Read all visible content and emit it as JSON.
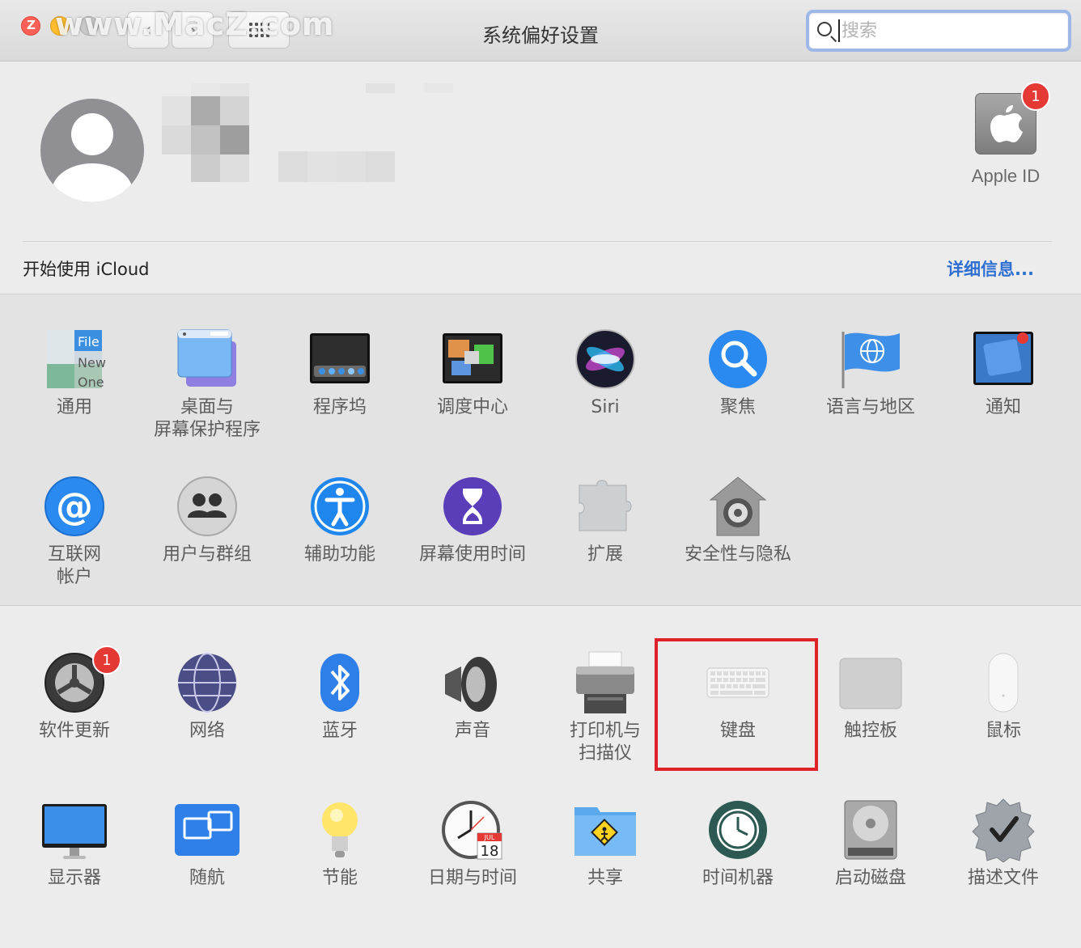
{
  "window": {
    "title": "系统偏好设置",
    "watermark": "www.MacZ.com"
  },
  "search": {
    "placeholder": "搜索",
    "value": ""
  },
  "account": {
    "apple_id_label": "Apple ID",
    "apple_id_badge": "1",
    "icloud_prompt": "开始使用 iCloud",
    "details_link": "详细信息..."
  },
  "section1": [
    {
      "label": "通用",
      "icon": "general-icon"
    },
    {
      "label": "桌面与\n屏幕保护程序",
      "icon": "desktop-screensaver-icon"
    },
    {
      "label": "程序坞",
      "icon": "dock-icon"
    },
    {
      "label": "调度中心",
      "icon": "mission-control-icon"
    },
    {
      "label": "Siri",
      "icon": "siri-icon"
    },
    {
      "label": "聚焦",
      "icon": "spotlight-icon"
    },
    {
      "label": "语言与地区",
      "icon": "language-region-icon"
    },
    {
      "label": "通知",
      "icon": "notifications-icon"
    },
    {
      "label": "互联网\n帐户",
      "icon": "internet-accounts-icon"
    },
    {
      "label": "用户与群组",
      "icon": "users-groups-icon"
    },
    {
      "label": "辅助功能",
      "icon": "accessibility-icon"
    },
    {
      "label": "屏幕使用时间",
      "icon": "screen-time-icon"
    },
    {
      "label": "扩展",
      "icon": "extensions-icon"
    },
    {
      "label": "安全性与隐私",
      "icon": "security-privacy-icon"
    }
  ],
  "section2": [
    {
      "label": "软件更新",
      "icon": "software-update-icon",
      "badge": "1"
    },
    {
      "label": "网络",
      "icon": "network-icon"
    },
    {
      "label": "蓝牙",
      "icon": "bluetooth-icon"
    },
    {
      "label": "声音",
      "icon": "sound-icon"
    },
    {
      "label": "打印机与\n扫描仪",
      "icon": "printers-scanners-icon"
    },
    {
      "label": "键盘",
      "icon": "keyboard-icon",
      "highlighted": true
    },
    {
      "label": "触控板",
      "icon": "trackpad-icon"
    },
    {
      "label": "鼠标",
      "icon": "mouse-icon"
    },
    {
      "label": "显示器",
      "icon": "displays-icon"
    },
    {
      "label": "随航",
      "icon": "sidecar-icon"
    },
    {
      "label": "节能",
      "icon": "energy-saver-icon"
    },
    {
      "label": "日期与时间",
      "icon": "date-time-icon"
    },
    {
      "label": "共享",
      "icon": "sharing-icon"
    },
    {
      "label": "时间机器",
      "icon": "time-machine-icon"
    },
    {
      "label": "启动磁盘",
      "icon": "startup-disk-icon"
    },
    {
      "label": "描述文件",
      "icon": "profiles-icon"
    }
  ],
  "icon_text": {
    "general_file": "File",
    "general_new": "New",
    "general_one": "One",
    "calendar_month": "JUL",
    "calendar_day": "18"
  },
  "colors": {
    "accent": "#2f6fd1",
    "badge": "#e53935",
    "highlight": "#e0202a"
  }
}
